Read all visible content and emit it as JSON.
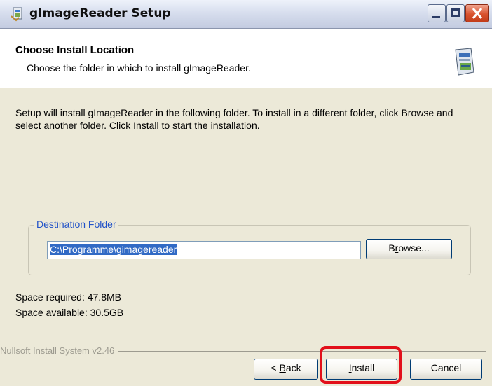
{
  "window": {
    "title": "gImageReader Setup"
  },
  "header": {
    "title": "Choose Install Location",
    "subtitle": "Choose the folder in which to install gImageReader."
  },
  "body": {
    "description": "Setup will install gImageReader in the following folder. To install in a different folder, click Browse and select another folder. Click Install to start the installation.",
    "destination": {
      "legend": "Destination Folder",
      "path_value": "C:\\Programme\\gimagereader",
      "browse_label_pre": "B",
      "browse_label_accel": "r",
      "browse_label_post": "owse..."
    },
    "space_required": "Space required: 47.8MB",
    "space_available": "Space available: 30.5GB"
  },
  "footer": {
    "branding": "Nullsoft Install System v2.46",
    "back_label_pre": "< ",
    "back_label_accel": "B",
    "back_label_post": "ack",
    "install_label_accel": "I",
    "install_label_post": "nstall",
    "cancel_label": "Cancel"
  },
  "icons": {
    "app_icon": "installer-app-icon",
    "header_icon": "installer-disk-icon",
    "minimize": "minimize-icon",
    "maximize": "maximize-icon",
    "close": "close-icon"
  },
  "colors": {
    "highlight": "#e2101a",
    "legend": "#2152c8",
    "selection": "#316ac5"
  }
}
